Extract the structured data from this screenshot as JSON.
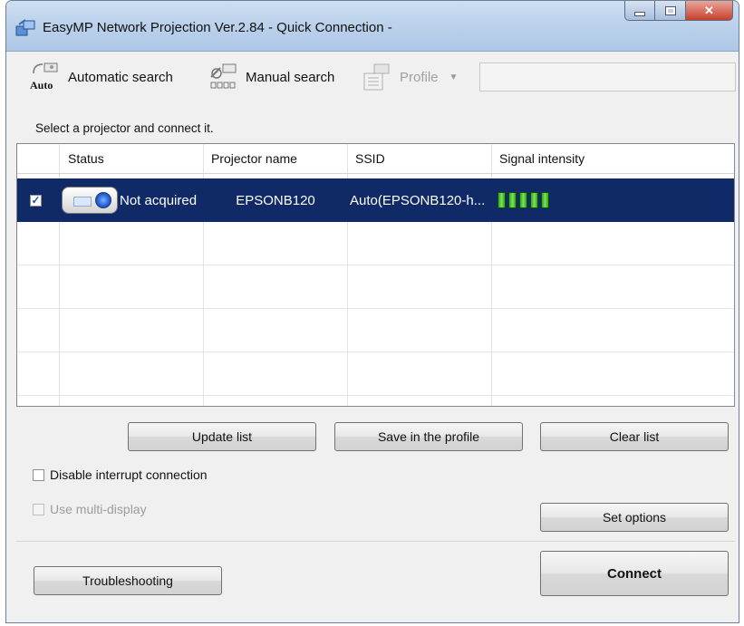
{
  "window": {
    "title": "EasyMP Network Projection Ver.2.84 - Quick Connection -"
  },
  "toolbar": {
    "auto_label": "Automatic search",
    "auto_badge": "Auto",
    "manual_label": "Manual search",
    "profile_label": "Profile",
    "profile_field_value": ""
  },
  "prompt": "Select a projector and connect it.",
  "list": {
    "columns": [
      "Status",
      "Projector name",
      "SSID",
      "Signal intensity"
    ],
    "rows": [
      {
        "checked": true,
        "status": "Not acquired",
        "projector_name": "EPSONB120",
        "ssid": "Auto(EPSONB120-h...",
        "signal_bars": 5
      }
    ]
  },
  "buttons": {
    "update_list": "Update list",
    "save_profile": "Save in the profile",
    "clear_list": "Clear list",
    "set_options": "Set options",
    "troubleshooting": "Troubleshooting",
    "connect": "Connect"
  },
  "options": {
    "disable_interrupt": "Disable interrupt connection",
    "disable_interrupt_checked": false,
    "multi_display": "Use multi-display",
    "multi_display_checked": false,
    "multi_display_enabled": false
  },
  "colors": {
    "selection": "#0f2a66",
    "signal_green": "#4cc22f",
    "titlebar": "#bcd2ec",
    "close_button": "#c6402b"
  }
}
